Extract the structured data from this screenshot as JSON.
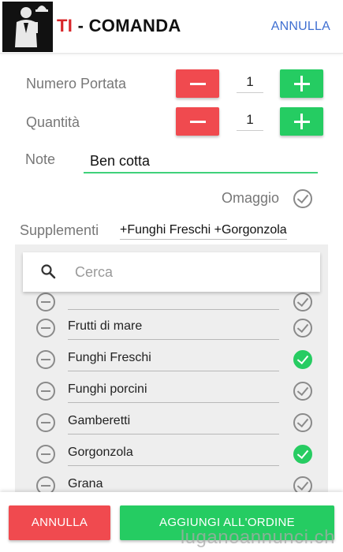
{
  "header": {
    "title_prefix": "TI",
    "title_rest": " - COMANDA",
    "cancel_label": "ANNULLA"
  },
  "form": {
    "portata_label": "Numero Portata",
    "portata_value": "1",
    "quantita_label": "Quantità",
    "quantita_value": "1",
    "note_label": "Note",
    "note_value": "Ben cotta",
    "omaggio_label": "Omaggio",
    "omaggio_checked": false,
    "supplementi_label": "Supplementi",
    "supplementi_value": "+Funghi Freschi +Gorgonzola"
  },
  "search": {
    "placeholder": "Cerca",
    "icon": "search-icon"
  },
  "supplements": [
    {
      "name": "",
      "checked": false
    },
    {
      "name": "Frutti di mare",
      "checked": false
    },
    {
      "name": "Funghi Freschi",
      "checked": true
    },
    {
      "name": "Funghi porcini",
      "checked": false
    },
    {
      "name": "Gamberetti",
      "checked": false
    },
    {
      "name": "Gorgonzola",
      "checked": true
    },
    {
      "name": "Grana",
      "checked": false
    }
  ],
  "footer": {
    "cancel_label": "ANNULLA",
    "add_label": "AGGIUNGI ALL'ORDINE",
    "watermark": "luganoannunci.ch"
  },
  "colors": {
    "accent_red": "#f04a4f",
    "accent_green": "#25cc62",
    "link_blue": "#3f6fd1"
  }
}
